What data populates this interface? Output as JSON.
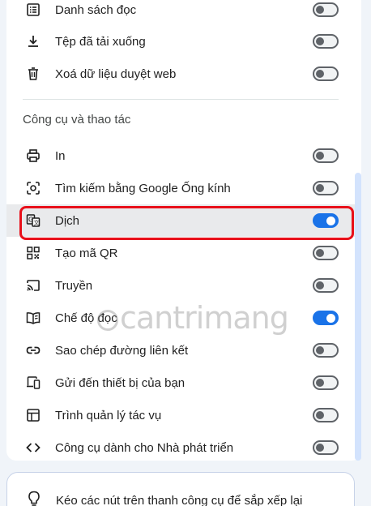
{
  "menu_items_top": [
    {
      "label": "Danh sách đọc",
      "icon": "reading-list-icon",
      "toggle_on": false
    },
    {
      "label": "Tệp đã tải xuống",
      "icon": "download-icon",
      "toggle_on": false
    },
    {
      "label": "Xoá dữ liệu duyệt web",
      "icon": "trash-icon",
      "toggle_on": false
    }
  ],
  "section_title": "Công cụ và thao tác",
  "menu_items_tools": [
    {
      "label": "In",
      "icon": "printer-icon",
      "toggle_on": false
    },
    {
      "label": "Tìm kiếm bằng Google Ống kính",
      "icon": "google-lens-icon",
      "toggle_on": false
    },
    {
      "label": "Dịch",
      "icon": "translate-icon",
      "toggle_on": true,
      "highlighted": true
    },
    {
      "label": "Tạo mã QR",
      "icon": "qr-code-icon",
      "toggle_on": false
    },
    {
      "label": "Truyền",
      "icon": "cast-icon",
      "toggle_on": false
    },
    {
      "label": "Chế độ đọc",
      "icon": "reader-mode-icon",
      "toggle_on": true
    },
    {
      "label": "Sao chép đường liên kết",
      "icon": "link-icon",
      "toggle_on": false
    },
    {
      "label": "Gửi đến thiết bị của bạn",
      "icon": "devices-icon",
      "toggle_on": false
    },
    {
      "label": "Trình quản lý tác vụ",
      "icon": "task-manager-icon",
      "toggle_on": false
    },
    {
      "label": "Công cụ dành cho Nhà phát triển",
      "icon": "code-icon",
      "toggle_on": false
    }
  ],
  "hint": {
    "text": "Kéo các nút trên thanh công cụ để sắp xếp lại",
    "icon": "lightbulb-icon"
  },
  "watermark": "cantrimang",
  "colors": {
    "accent": "#1a73e8",
    "highlight_border": "#e8101a",
    "background": "#f0f4f9"
  }
}
